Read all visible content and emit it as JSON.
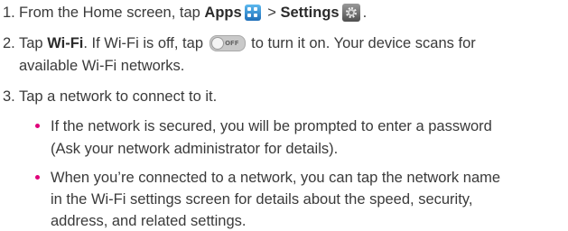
{
  "step1": {
    "number": "1.",
    "text_before": "From the Home screen, tap ",
    "apps_label": "Apps",
    "separator": " > ",
    "settings_label": "Settings"
  },
  "step2": {
    "number": "2.",
    "text_before": "Tap ",
    "wifi_label": "Wi-Fi",
    "text_after_label": ". If Wi-Fi is off, tap",
    "text_after_toggle": " to turn it on. Your device scans for",
    "continuation": "available Wi-Fi networks.",
    "toggle_text": "OFF"
  },
  "step3": {
    "number": "3.",
    "text": "Tap a network to connect to it."
  },
  "bullets": [
    {
      "lines": [
        "If the network is secured, you will be prompted to enter a password",
        "(Ask your network administrator for details)."
      ]
    },
    {
      "lines": [
        "When you’re connected to a network, you can tap the network name",
        "in the Wi-Fi settings screen for details about the speed, security,",
        "address, and related settings."
      ]
    }
  ],
  "colors": {
    "text": "#3a3a3a",
    "bullet": "#e0007a",
    "apps_icon": "#1f6fb8",
    "settings_icon": "#5a5a5a"
  },
  "icons": {
    "apps": "apps-grid-icon",
    "settings": "settings-gear-icon",
    "toggle": "toggle-off-icon"
  }
}
